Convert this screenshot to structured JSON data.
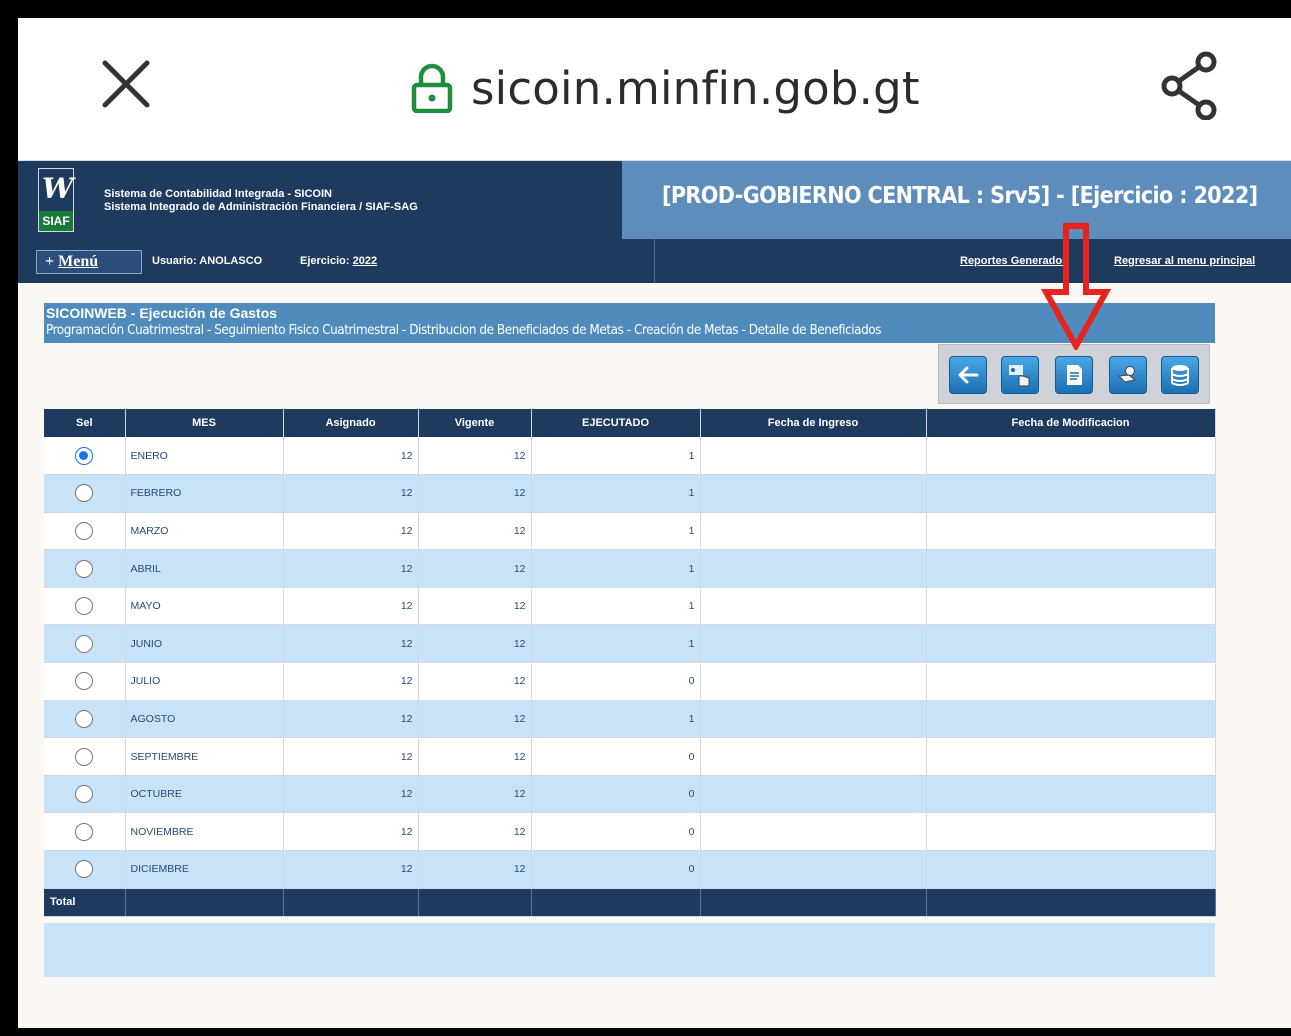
{
  "browser": {
    "url": "sicoin.minfin.gob.gt"
  },
  "header": {
    "logo_text": "SIAF",
    "system_line1": "Sistema de Contabilidad Integrada - SICOIN",
    "system_line2": "Sistema Integrado de Administración Financiera / SIAF-SAG",
    "environment_title": "[PROD-GOBIERNO CENTRAL : Srv5] - [Ejercicio : 2022]"
  },
  "nav": {
    "menu_plus": "+",
    "menu_label": "Menú",
    "usuario_label": "Usuario: ANOLASCO",
    "ejercicio_label": "Ejercicio:",
    "ejercicio_value": "2022",
    "reportes": "Reportes Generados",
    "regresar": "Regresar al menu principal"
  },
  "section": {
    "title": "SICOINWEB - Ejecución de Gastos",
    "breadcrumb": [
      "Programación Cuatrimestral",
      "Seguimiento Fisico Cuatrimestral",
      "Distribucion de Beneficiados de Metas",
      "Creación de Metas",
      "Detalle de Beneficiados"
    ],
    "separator": " - "
  },
  "toolbar": {
    "icons": [
      "back-arrow-icon",
      "hand-select-icon",
      "document-icon",
      "hand-gear-icon",
      "database-icon"
    ]
  },
  "table": {
    "columns": [
      "Sel",
      "MES",
      "Asignado",
      "Vigente",
      "EJECUTADO",
      "Fecha de Ingreso",
      "Fecha de Modificacion"
    ],
    "rows": [
      {
        "selected": true,
        "mes": "ENERO",
        "asignado": "12",
        "vigente": "12",
        "ejecutado": "1",
        "ingreso": "",
        "modificacion": ""
      },
      {
        "selected": false,
        "mes": "FEBRERO",
        "asignado": "12",
        "vigente": "12",
        "ejecutado": "1",
        "ingreso": "",
        "modificacion": ""
      },
      {
        "selected": false,
        "mes": "MARZO",
        "asignado": "12",
        "vigente": "12",
        "ejecutado": "1",
        "ingreso": "",
        "modificacion": ""
      },
      {
        "selected": false,
        "mes": "ABRIL",
        "asignado": "12",
        "vigente": "12",
        "ejecutado": "1",
        "ingreso": "",
        "modificacion": ""
      },
      {
        "selected": false,
        "mes": "MAYO",
        "asignado": "12",
        "vigente": "12",
        "ejecutado": "1",
        "ingreso": "",
        "modificacion": ""
      },
      {
        "selected": false,
        "mes": "JUNIO",
        "asignado": "12",
        "vigente": "12",
        "ejecutado": "1",
        "ingreso": "",
        "modificacion": ""
      },
      {
        "selected": false,
        "mes": "JULIO",
        "asignado": "12",
        "vigente": "12",
        "ejecutado": "0",
        "ingreso": "",
        "modificacion": ""
      },
      {
        "selected": false,
        "mes": "AGOSTO",
        "asignado": "12",
        "vigente": "12",
        "ejecutado": "1",
        "ingreso": "",
        "modificacion": ""
      },
      {
        "selected": false,
        "mes": "SEPTIEMBRE",
        "asignado": "12",
        "vigente": "12",
        "ejecutado": "0",
        "ingreso": "",
        "modificacion": ""
      },
      {
        "selected": false,
        "mes": "OCTUBRE",
        "asignado": "12",
        "vigente": "12",
        "ejecutado": "0",
        "ingreso": "",
        "modificacion": ""
      },
      {
        "selected": false,
        "mes": "NOVIEMBRE",
        "asignado": "12",
        "vigente": "12",
        "ejecutado": "0",
        "ingreso": "",
        "modificacion": ""
      },
      {
        "selected": false,
        "mes": "DICIEMBRE",
        "asignado": "12",
        "vigente": "12",
        "ejecutado": "0",
        "ingreso": "",
        "modificacion": ""
      }
    ],
    "total_label": "Total"
  },
  "colors": {
    "navy": "#1f3a5f",
    "header_light": "#5e8dbb",
    "title_bar": "#4f8bbd",
    "row_alt": "#c8e2f7",
    "annotation_red": "#e8231f",
    "radio_selected": "#1a73e8"
  }
}
